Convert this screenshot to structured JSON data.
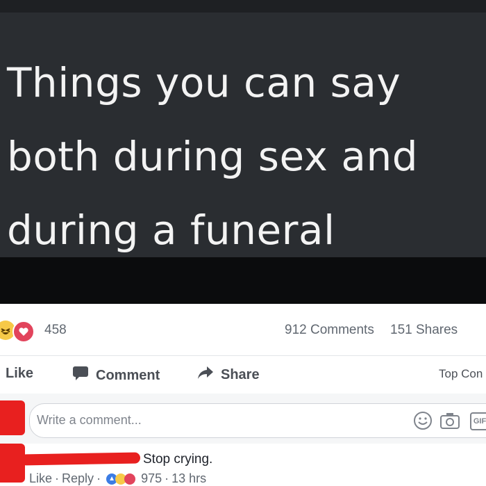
{
  "post": {
    "lines": [
      "Things you can say",
      "both during sex and",
      "during a funeral"
    ]
  },
  "stats": {
    "reactions_count": "458",
    "comments": "912 Comments",
    "shares": "151 Shares"
  },
  "actions": {
    "like": "Like",
    "comment": "Comment",
    "share": "Share",
    "top_comments": "Top Con"
  },
  "composer": {
    "placeholder": "Write a comment..."
  },
  "comment": {
    "text": "Stop crying.",
    "like": "Like",
    "reply": "Reply",
    "reaction_count": "975",
    "time": "13 hrs"
  },
  "colors": {
    "post_background": "#2a2d31",
    "redaction": "#e8201f",
    "meta_text": "#606770"
  },
  "icons": [
    "haha-reaction-icon",
    "love-reaction-icon",
    "comment-icon",
    "share-arrow-icon",
    "emoji-icon",
    "camera-icon",
    "gif-icon"
  ]
}
